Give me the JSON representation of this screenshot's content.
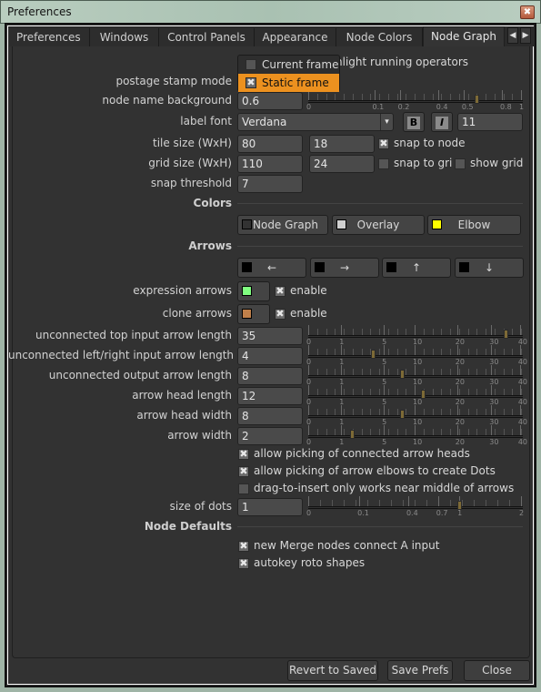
{
  "window": {
    "title": "Preferences",
    "close_glyph": "✖"
  },
  "tabs": [
    {
      "label": "Preferences",
      "active": false
    },
    {
      "label": "Windows",
      "active": false
    },
    {
      "label": "Control Panels",
      "active": false
    },
    {
      "label": "Appearance",
      "active": false
    },
    {
      "label": "Node Colors",
      "active": false
    },
    {
      "label": "Node Graph",
      "active": true
    }
  ],
  "tab_nav": {
    "prev": "◀",
    "next": "▶"
  },
  "highlight_running_operators": {
    "label_visible": "hlight running operators",
    "checked": false
  },
  "postage_stamp_mode": {
    "label": "postage stamp mode",
    "options": [
      {
        "label": "Current frame",
        "checked": false,
        "selected": false
      },
      {
        "label": "Static frame",
        "checked": true,
        "selected": true
      }
    ]
  },
  "node_name_background": {
    "label": "node name background",
    "value": "0.6",
    "slider": {
      "ticks": [
        "0",
        "0.1",
        "0.2",
        "0.4",
        "0.5",
        "0.8",
        "1"
      ],
      "value": 0.6
    }
  },
  "label_font": {
    "label": "label font",
    "font": "Verdana",
    "bold_glyph": "B",
    "italic_glyph": "I",
    "size": "11",
    "dropdown_glyph": "▾"
  },
  "tile_size": {
    "label": "tile size (WxH)",
    "w": "80",
    "h": "18",
    "snap_to_node": {
      "label": "snap to node",
      "checked": true
    }
  },
  "grid_size": {
    "label": "grid size (WxH)",
    "w": "110",
    "h": "24",
    "snap_to_grid": {
      "label": "snap to gri",
      "checked": false
    },
    "show_grid": {
      "label": "show grid",
      "checked": false
    }
  },
  "snap_threshold": {
    "label": "snap threshold",
    "value": "7"
  },
  "colors": {
    "heading": "Colors",
    "buttons": [
      {
        "label": "Node Graph",
        "color": "#323232"
      },
      {
        "label": "Overlay",
        "color": "#d0d0d0"
      },
      {
        "label": "Elbow",
        "color": "#ffff00"
      }
    ]
  },
  "arrows": {
    "heading": "Arrows",
    "direction_buttons": [
      {
        "glyph": "←",
        "color": "#000000"
      },
      {
        "glyph": "→",
        "color": "#000000"
      },
      {
        "glyph": "↑",
        "color": "#000000"
      },
      {
        "glyph": "↓",
        "color": "#000000"
      }
    ],
    "expression_arrows": {
      "label": "expression arrows",
      "color": "#80ff80",
      "enable_label": "enable",
      "enabled": true
    },
    "clone_arrows": {
      "label": "clone arrows",
      "color": "#c0804a",
      "enable_label": "enable",
      "enabled": true
    },
    "slider_ticks": [
      "0",
      "1",
      "5",
      "10",
      "20",
      "30",
      "40"
    ],
    "sliders": [
      {
        "label": "unconnected top input arrow length",
        "value": "35"
      },
      {
        "label": "unconnected left/right input arrow length",
        "value": "4"
      },
      {
        "label": "unconnected output arrow length",
        "value": "8"
      },
      {
        "label": "arrow head length",
        "value": "12"
      },
      {
        "label": "arrow head width",
        "value": "8"
      },
      {
        "label": "arrow width",
        "value": "2"
      }
    ],
    "options": [
      {
        "label": "allow picking of connected arrow heads",
        "checked": true
      },
      {
        "label": "allow picking of arrow elbows to create Dots",
        "checked": true
      },
      {
        "label": "drag-to-insert only works near middle of arrows",
        "checked": false
      }
    ],
    "size_of_dots": {
      "label": "size of dots",
      "value": "1",
      "ticks": [
        "0",
        "0.1",
        "0.4",
        "0.7",
        "1",
        "2"
      ]
    }
  },
  "node_defaults": {
    "heading": "Node Defaults",
    "options": [
      {
        "label": "new Merge nodes connect A input",
        "checked": true
      },
      {
        "label": "autokey roto shapes",
        "checked": true
      }
    ]
  },
  "footer": {
    "revert": "Revert to Saved",
    "save": "Save Prefs",
    "close": "Close"
  },
  "check_glyph": "✖"
}
